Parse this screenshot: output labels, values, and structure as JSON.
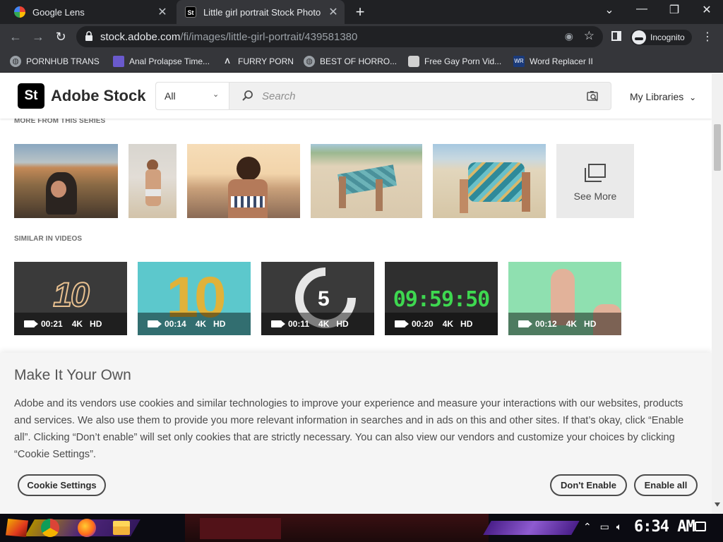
{
  "browser": {
    "tabs": [
      {
        "title": "Google Lens",
        "favicon_color": "#4285f4"
      },
      {
        "title": "Little girl portrait Stock Photo",
        "favicon_text": "St"
      }
    ],
    "url_host": "stock.adobe.com",
    "url_path": "/fi/images/little-girl-portrait/439581380",
    "incognito_label": "Incognito",
    "bookmarks": [
      "PORNHUB TRANS",
      "Anal Prolapse Time...",
      "FURRY PORN",
      "BEST OF HORRO...",
      "Free Gay Porn Vid...",
      "Word Replacer II"
    ]
  },
  "header": {
    "logo_text": "St",
    "brand": "Adobe Stock",
    "filter_label": "All",
    "search_placeholder": "Search",
    "my_libraries": "My Libraries"
  },
  "series": {
    "heading": "MORE FROM THIS SERIES",
    "see_more": "See More"
  },
  "videos": {
    "heading": "SIMILAR IN VIDEOS",
    "items": [
      {
        "overlay": "10",
        "duration": "00:21",
        "res": "4K",
        "quality": "HD"
      },
      {
        "overlay": "10",
        "duration": "00:14",
        "res": "4K",
        "quality": "HD"
      },
      {
        "overlay": "5",
        "duration": "00:11",
        "res": "4K",
        "quality": "HD"
      },
      {
        "overlay": "09:59:50",
        "duration": "00:20",
        "res": "4K",
        "quality": "HD"
      },
      {
        "overlay": "",
        "duration": "00:12",
        "res": "4K",
        "quality": "HD"
      }
    ]
  },
  "cookie": {
    "title": "Make It Your Own",
    "body": "Adobe and its vendors use cookies and similar technologies to improve your experience and measure your interactions with our websites, products and services. We also use them to provide you more relevant information in searches and in ads on this and other sites. If that’s okay, click “Enable all”. Clicking “Don’t enable” will set only cookies that are strictly necessary. You can also view our vendors and customize your choices by clicking “Cookie Settings”.",
    "settings_label": "Cookie Settings",
    "dont_enable_label": "Don't Enable",
    "enable_all_label": "Enable all"
  },
  "taskbar": {
    "time": "6:34 AM"
  }
}
